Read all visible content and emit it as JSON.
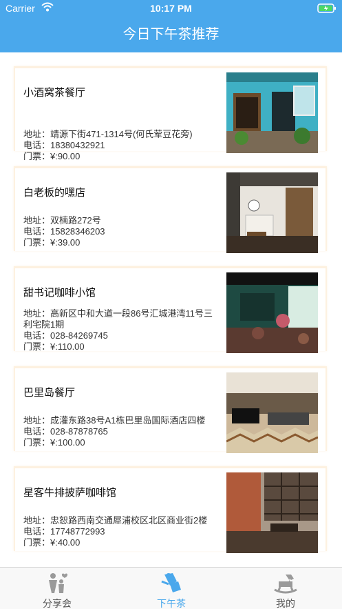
{
  "status_bar": {
    "carrier": "Carrier",
    "time": "10:17 PM"
  },
  "nav": {
    "title": "今日下午茶推荐"
  },
  "restaurants": [
    {
      "name": "小酒窝茶餐厅",
      "address": "地址：靖源下街471-1314号(何氏荤豆花旁)",
      "phone": "电话：18380432921",
      "ticket": "门票：¥:90.00"
    },
    {
      "name": "白老板的嘿店",
      "address": "地址：双楠路272号",
      "phone": "电话：15828346203",
      "ticket": "门票：¥:39.00"
    },
    {
      "name": "甜书记咖啡小馆",
      "address": "地址：高新区中和大道一段86号汇城港湾11号三利宅院1期",
      "phone": "电话：028-84269745",
      "ticket": "门票：¥:110.00"
    },
    {
      "name": "巴里岛餐厅",
      "address": "地址：成灌东路38号A1栋巴里岛国际酒店四楼",
      "phone": "电话：028-87878765",
      "ticket": "门票：¥:100.00"
    },
    {
      "name": "星客牛排披萨咖啡馆",
      "address": "地址：忠恕路西南交通犀浦校区北区商业街2楼",
      "phone": "电话：17748772993",
      "ticket": "门票：¥:40.00"
    }
  ],
  "tabs": [
    {
      "label": "分享会",
      "icon": "people-icon"
    },
    {
      "label": "下午茶",
      "icon": "tea-icon"
    },
    {
      "label": "我的",
      "icon": "rocking-horse-icon"
    }
  ],
  "colors": {
    "accent": "#4aa8ec",
    "card_border": "#fdf1e0",
    "tab_inactive": "#555555"
  }
}
